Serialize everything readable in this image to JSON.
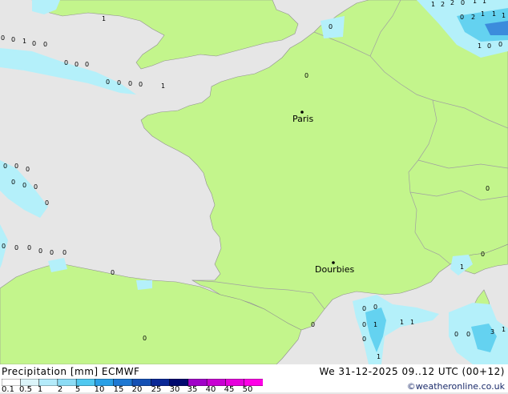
{
  "map": {
    "cities": [
      {
        "name": "Paris"
      },
      {
        "name": "Dourbies"
      }
    ],
    "colors": {
      "sea": "#e6e6e6",
      "land": "#c3f58c",
      "border": "#a0a0a0",
      "coast": "#909090",
      "precip_light": "#b4f0fa",
      "precip_mid": "#64d2f0",
      "precip_heavy": "#3c8cdc"
    },
    "precip_values": [
      "0",
      "0",
      "1",
      "0",
      "0",
      "0",
      "0",
      "0",
      "0",
      "0",
      "0",
      "0",
      "1",
      "1",
      "1",
      "2",
      "2",
      "0",
      "1",
      "1",
      "0",
      "2",
      "1",
      "1",
      "1",
      "1",
      "0",
      "0",
      "0",
      "0",
      "0",
      "0",
      "0",
      "0",
      "0",
      "0",
      "0",
      "0",
      "0",
      "0",
      "0",
      "0",
      "0",
      "0",
      "0",
      "0",
      "0",
      "0",
      "0",
      "1",
      "0",
      "1",
      "1",
      "1",
      "0",
      "0",
      "0",
      "0",
      "3",
      "1",
      "1"
    ]
  },
  "footer": {
    "title": "Precipitation [mm]  ECMWF",
    "datetime": "We 31-12-2025 09..12 UTC (00+12)",
    "credit": "©weatheronline.co.uk",
    "legend_ticks": [
      "0.1",
      "0.5",
      "1",
      "2",
      "5",
      "10",
      "15",
      "20",
      "25",
      "30",
      "35",
      "40",
      "45",
      "50"
    ],
    "legend_colors": [
      "#ffffff",
      "#dcf5fa",
      "#b4ebfa",
      "#8cdcf5",
      "#50c8f0",
      "#2aa0e6",
      "#1e78d2",
      "#1450b4",
      "#0a2896",
      "#000a6e",
      "#a000c8",
      "#c800d2",
      "#e600dc",
      "#ff00e6"
    ]
  }
}
